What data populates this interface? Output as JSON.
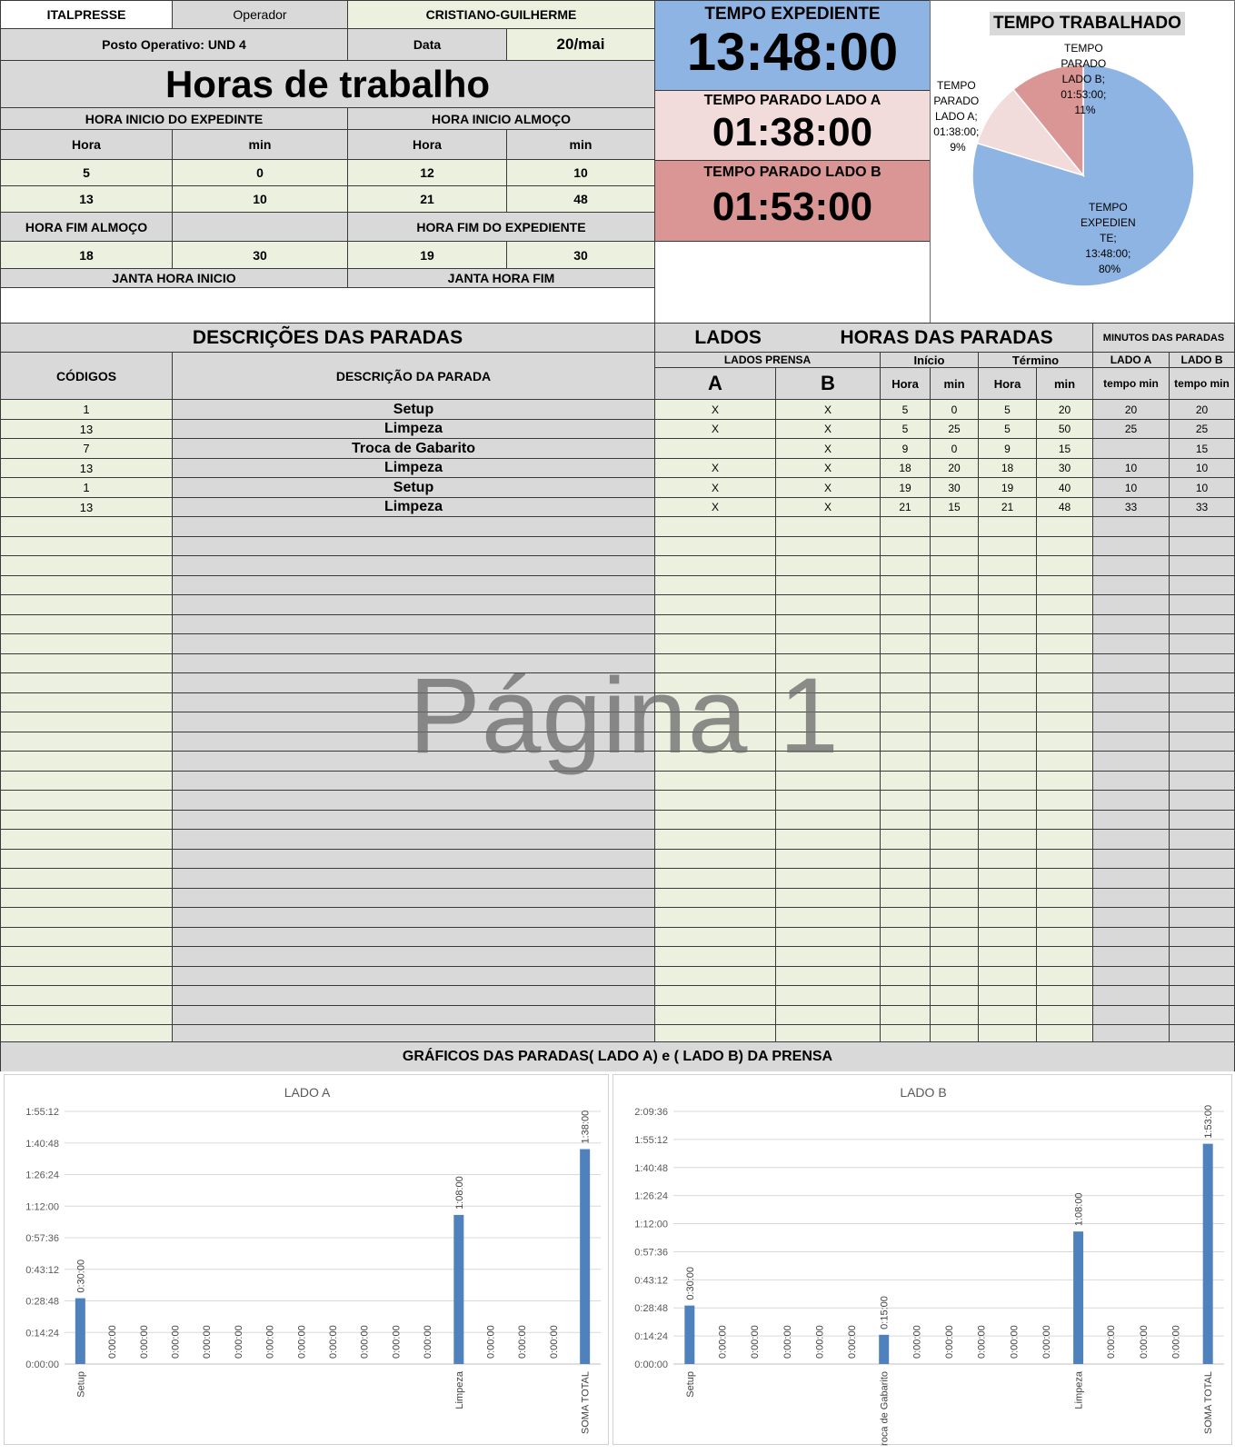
{
  "header": {
    "company": "ITALPRESSE",
    "operator_label": "Operador",
    "operator_name": "CRISTIANO-GUILHERME",
    "posto": "Posto Operativo: UND 4",
    "data_label": "Data",
    "data_value": "20/mai",
    "title": "Horas de trabalho"
  },
  "schedule": {
    "inicio_expediente": "HORA INICIO DO EXPEDINTE",
    "inicio_almoco": "HORA INICIO ALMOÇO",
    "hora": "Hora",
    "min": "min",
    "row1": [
      "5",
      "0",
      "12",
      "10"
    ],
    "row2": [
      "13",
      "10",
      "21",
      "48"
    ],
    "fim_almoco": "HORA FIM ALMOÇO",
    "fim_expediente": "HORA FIM DO EXPEDIENTE",
    "row3": [
      "18",
      "30",
      "19",
      "30"
    ],
    "janta_inicio": "JANTA HORA INICIO",
    "janta_fim": "JANTA HORA FIM"
  },
  "totals": {
    "expediente_label": "TEMPO EXPEDIENTE",
    "expediente_value": "13:48:00",
    "lado_a_label": "TEMPO PARADO LADO A",
    "lado_a_value": "01:38:00",
    "lado_b_label": "TEMPO PARADO LADO B",
    "lado_b_value": "01:53:00"
  },
  "pie": {
    "title": "TEMPO TRABALHADO",
    "label_b": [
      "TEMPO",
      "PARADO",
      "LADO B;",
      "01:53:00;",
      "11%"
    ],
    "label_a": [
      "TEMPO",
      "PARADO",
      "LADO A;",
      "01:38:00;",
      "9%"
    ],
    "label_exp": [
      "TEMPO",
      "EXPEDIEN",
      "TE;",
      "13:48:00;",
      "80%"
    ],
    "colors": {
      "expediente": "#8db4e2",
      "lado_a": "#f2dcdb",
      "lado_b": "#da9694"
    }
  },
  "stops_table": {
    "title_desc": "DESCRIÇÕES DAS PARADAS",
    "title_lados": "LADOS",
    "title_horas": "HORAS DAS PARADAS",
    "title_minutos": "MINUTOS DAS PARADAS",
    "codigos": "CÓDIGOS",
    "descricao": "DESCRIÇÃO DA PARADA",
    "lados_prensa": "LADOS PRENSA",
    "inicio": "Início",
    "termino": "Término",
    "lado_a": "LADO A",
    "lado_b": "LADO B",
    "col_a": "A",
    "col_b": "B",
    "hora": "Hora",
    "min": "min",
    "tempo_min": "tempo min",
    "rows": [
      {
        "code": "1",
        "desc": "Setup",
        "a": "X",
        "b": "X",
        "ih": "5",
        "im": "0",
        "th": "5",
        "tm": "20",
        "ma": "20",
        "mb": "20"
      },
      {
        "code": "13",
        "desc": "Limpeza",
        "a": "X",
        "b": "X",
        "ih": "5",
        "im": "25",
        "th": "5",
        "tm": "50",
        "ma": "25",
        "mb": "25"
      },
      {
        "code": "7",
        "desc": "Troca de Gabarito",
        "a": "",
        "b": "X",
        "ih": "9",
        "im": "0",
        "th": "9",
        "tm": "15",
        "ma": "",
        "mb": "15"
      },
      {
        "code": "13",
        "desc": "Limpeza",
        "a": "X",
        "b": "X",
        "ih": "18",
        "im": "20",
        "th": "18",
        "tm": "30",
        "ma": "10",
        "mb": "10"
      },
      {
        "code": "1",
        "desc": "Setup",
        "a": "X",
        "b": "X",
        "ih": "19",
        "im": "30",
        "th": "19",
        "tm": "40",
        "ma": "10",
        "mb": "10"
      },
      {
        "code": "13",
        "desc": "Limpeza",
        "a": "X",
        "b": "X",
        "ih": "21",
        "im": "15",
        "th": "21",
        "tm": "48",
        "ma": "33",
        "mb": "33"
      }
    ]
  },
  "watermark": "Página 1",
  "charts_title": "GRÁFICOS DAS PARADAS( LADO A) e ( LADO B) DA PRENSA",
  "chart_data": [
    {
      "type": "bar",
      "title": "LADO A",
      "categories": [
        "Setup",
        "",
        "",
        "",
        "",
        "",
        "",
        "",
        "",
        "",
        "",
        "",
        "Limpeza",
        "",
        "",
        "",
        "SOMA TOTAL"
      ],
      "values_seconds": [
        1800,
        0,
        0,
        0,
        0,
        0,
        0,
        0,
        0,
        0,
        0,
        0,
        4080,
        0,
        0,
        0,
        5880
      ],
      "data_labels": [
        "0:30:00",
        "0:00:00",
        "0:00:00",
        "0:00:00",
        "0:00:00",
        "0:00:00",
        "0:00:00",
        "0:00:00",
        "0:00:00",
        "0:00:00",
        "0:00:00",
        "0:00:00",
        "1:08:00",
        "0:00:00",
        "0:00:00",
        "0:00:00",
        "1:38:00"
      ],
      "yticks": [
        "0:00:00",
        "0:14:24",
        "0:28:48",
        "0:43:12",
        "0:57:36",
        "1:12:00",
        "1:26:24",
        "1:40:48",
        "1:55:12"
      ],
      "ylim_seconds": [
        0,
        6912
      ],
      "color": "#4f81bd"
    },
    {
      "type": "bar",
      "title": "LADO B",
      "categories": [
        "Setup",
        "",
        "",
        "",
        "",
        "",
        "Troca de Gabarito",
        "",
        "",
        "",
        "",
        "",
        "Limpeza",
        "",
        "",
        "",
        "SOMA TOTAL"
      ],
      "values_seconds": [
        1800,
        0,
        0,
        0,
        0,
        0,
        900,
        0,
        0,
        0,
        0,
        0,
        4080,
        0,
        0,
        0,
        6780
      ],
      "data_labels": [
        "0:30:00",
        "0:00:00",
        "0:00:00",
        "0:00:00",
        "0:00:00",
        "0:00:00",
        "0:15:00",
        "0:00:00",
        "0:00:00",
        "0:00:00",
        "0:00:00",
        "0:00:00",
        "1:08:00",
        "0:00:00",
        "0:00:00",
        "0:00:00",
        "1:53:00"
      ],
      "yticks": [
        "0:00:00",
        "0:14:24",
        "0:28:48",
        "0:43:12",
        "0:57:36",
        "1:12:00",
        "1:26:24",
        "1:40:48",
        "1:55:12",
        "2:09:36"
      ],
      "ylim_seconds": [
        0,
        7776
      ],
      "color": "#4f81bd"
    }
  ]
}
